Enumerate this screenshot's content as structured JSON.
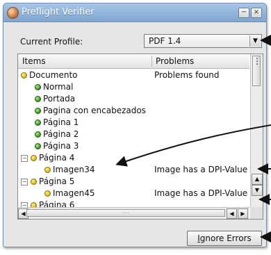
{
  "window": {
    "title": "Preflight Verifier"
  },
  "title_buttons": {
    "minimize": "−",
    "close": "×"
  },
  "profile": {
    "label": "Current Profile:",
    "value": "PDF 1.4",
    "arrow": "▼"
  },
  "tree": {
    "columns": [
      "Items",
      "Problems"
    ],
    "rows": [
      {
        "label": "Documento",
        "problem": "Problems found",
        "status": "yellow"
      },
      {
        "label": "Normal",
        "problem": "",
        "status": "green"
      },
      {
        "label": "Portada",
        "problem": "",
        "status": "green"
      },
      {
        "label": "Pagina con encabezados",
        "problem": "",
        "status": "green"
      },
      {
        "label": "Página 1",
        "problem": "",
        "status": "green"
      },
      {
        "label": "Página 2",
        "problem": "",
        "status": "green"
      },
      {
        "label": "Página 3",
        "problem": "",
        "status": "green"
      },
      {
        "label": "Página 4",
        "problem": "",
        "status": "yellow",
        "toggle": "−"
      },
      {
        "label": "Imagen34",
        "problem": "Image has a DPI-Value",
        "status": "yellow"
      },
      {
        "label": "Página 5",
        "problem": "",
        "status": "yellow",
        "toggle": "−"
      },
      {
        "label": "Imagen45",
        "problem": "Image has a DPI-Value",
        "status": "yellow"
      },
      {
        "label": "Página 6",
        "problem": "",
        "status": "yellow",
        "toggle": "−"
      }
    ]
  },
  "scroll": {
    "up": "▲",
    "down": "▼",
    "left": "◀",
    "right": "▶",
    "grip": "⋮",
    "hgrip": "····"
  },
  "buttons": {
    "ignore_mnemonic": "I",
    "ignore_rest": "gnore Errors"
  },
  "colors": {
    "status_ok": "#2f8f1a",
    "status_warning": "#d9b40a",
    "titlebar": "#7ea6d1"
  }
}
